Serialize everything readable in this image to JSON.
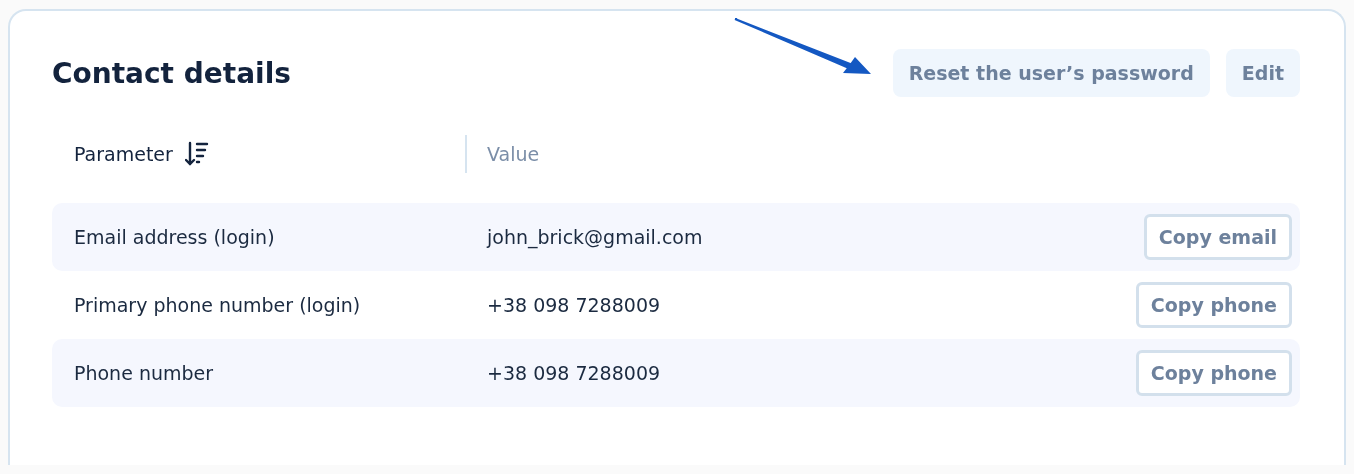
{
  "card": {
    "title": "Contact details",
    "actions": [
      {
        "label": "Reset the user’s password"
      },
      {
        "label": "Edit"
      }
    ],
    "table": {
      "columns": [
        {
          "label": "Parameter",
          "sortable": true
        },
        {
          "label": "Value",
          "sortable": false
        }
      ],
      "rows": [
        {
          "parameter": "Email address (login)",
          "value": "john_brick@gmail.com",
          "action": "Copy email"
        },
        {
          "parameter": "Primary phone number (login)",
          "value": "+38 098 7288009",
          "action": "Copy phone"
        },
        {
          "parameter": "Phone number",
          "value": "+38 098 7288009",
          "action": "Copy phone"
        }
      ]
    }
  }
}
